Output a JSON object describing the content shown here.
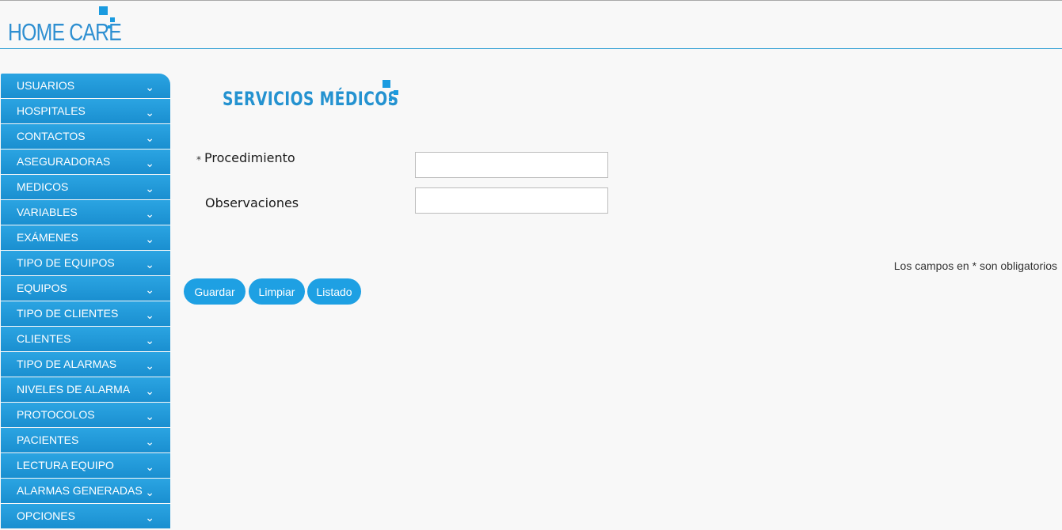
{
  "header": {
    "logo_text": "HOME CARE"
  },
  "sidebar": {
    "items": [
      {
        "label": "USUARIOS"
      },
      {
        "label": "HOSPITALES"
      },
      {
        "label": "CONTACTOS"
      },
      {
        "label": "ASEGURADORAS"
      },
      {
        "label": "MEDICOS"
      },
      {
        "label": "VARIABLES"
      },
      {
        "label": "EXÁMENES"
      },
      {
        "label": "TIPO DE EQUIPOS"
      },
      {
        "label": "EQUIPOS"
      },
      {
        "label": "TIPO DE CLIENTES"
      },
      {
        "label": "CLIENTES"
      },
      {
        "label": "TIPO DE ALARMAS"
      },
      {
        "label": "NIVELES DE ALARMA"
      },
      {
        "label": "PROTOCOLOS"
      },
      {
        "label": "PACIENTES"
      },
      {
        "label": "LECTURA EQUIPO"
      },
      {
        "label": "ALARMAS GENERADAS"
      },
      {
        "label": "OPCIONES"
      }
    ],
    "chevron": "⌄"
  },
  "main": {
    "title": "SERVICIOS MÉDICOS",
    "required_marker": "*",
    "fields": {
      "procedimiento": {
        "label": "Procedimiento",
        "value": ""
      },
      "observaciones": {
        "label": "Observaciones",
        "value": ""
      }
    },
    "required_note": "Los campos en * son obligatorios",
    "buttons": {
      "save": "Guardar",
      "clear": "Limpiar",
      "list": "Listado"
    }
  },
  "colors": {
    "accent": "#1ea0e3",
    "title": "#2492d0",
    "logo": "#2e8fd1"
  }
}
